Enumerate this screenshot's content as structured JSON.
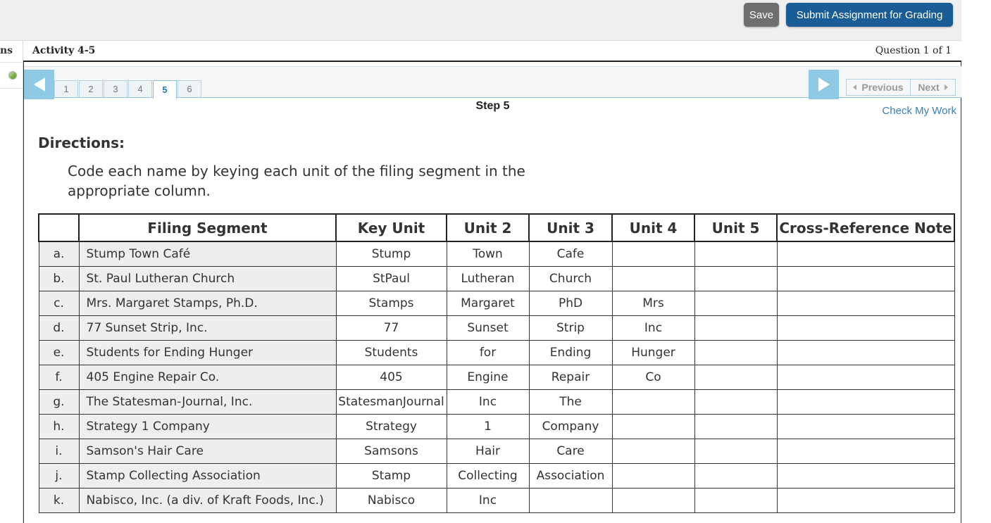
{
  "toolbar": {
    "save_label": "Save",
    "submit_label": "Submit Assignment for Grading"
  },
  "left_panel": {
    "fragment_text": "ns"
  },
  "activity": {
    "title": "Activity 4-5",
    "question_counter": "Question 1 of 1"
  },
  "steps": {
    "tabs": [
      "1",
      "2",
      "3",
      "4",
      "5",
      "6"
    ],
    "active_tab": "5",
    "previous_label": "Previous",
    "next_label": "Next",
    "current_step_label": "Step 5",
    "check_work_label": "Check My Work"
  },
  "directions": {
    "title": "Directions:",
    "text": "Code each name by keying each unit of the filing segment in the appropriate column."
  },
  "table": {
    "headers": [
      "",
      "Filing Segment",
      "Key Unit",
      "Unit 2",
      "Unit 3",
      "Unit 4",
      "Unit 5",
      "Cross-Reference Note"
    ],
    "rows": [
      {
        "label": "a.",
        "segment": "Stump Town Café",
        "units": [
          "Stump",
          "Town",
          "Cafe",
          "",
          ""
        ],
        "note": ""
      },
      {
        "label": "b.",
        "segment": "St. Paul Lutheran Church",
        "units": [
          "StPaul",
          "Lutheran",
          "Church",
          "",
          ""
        ],
        "note": ""
      },
      {
        "label": "c.",
        "segment": "Mrs. Margaret Stamps, Ph.D.",
        "units": [
          "Stamps",
          "Margaret",
          "PhD",
          "Mrs",
          ""
        ],
        "note": ""
      },
      {
        "label": "d.",
        "segment": "77 Sunset Strip, Inc.",
        "units": [
          "77",
          "Sunset",
          "Strip",
          "Inc",
          ""
        ],
        "note": ""
      },
      {
        "label": "e.",
        "segment": "Students for Ending Hunger",
        "units": [
          "Students",
          "for",
          "Ending",
          "Hunger",
          ""
        ],
        "note": ""
      },
      {
        "label": "f.",
        "segment": "405 Engine Repair Co.",
        "units": [
          "405",
          "Engine",
          "Repair",
          "Co",
          ""
        ],
        "note": ""
      },
      {
        "label": "g.",
        "segment": "The Statesman-Journal, Inc.",
        "units": [
          "StatesmanJournal",
          "Inc",
          "The",
          "",
          ""
        ],
        "note": ""
      },
      {
        "label": "h.",
        "segment": "Strategy 1 Company",
        "units": [
          "Strategy",
          "1",
          "Company",
          "",
          ""
        ],
        "note": ""
      },
      {
        "label": "i.",
        "segment": "Samson's Hair Care",
        "units": [
          "Samsons",
          "Hair",
          "Care",
          "",
          ""
        ],
        "note": ""
      },
      {
        "label": "j.",
        "segment": "Stamp Collecting Association",
        "units": [
          "Stamp",
          "Collecting",
          "Association",
          "",
          ""
        ],
        "note": ""
      },
      {
        "label": "k.",
        "segment": "Nabisco, Inc. (a div. of Kraft Foods, Inc.)",
        "units": [
          "Nabisco",
          "Inc",
          "",
          "",
          ""
        ],
        "note": ""
      }
    ]
  },
  "colors": {
    "submit_button": "#1a5d96",
    "save_button": "#6f6f6f",
    "step_arrow": "#8ec9e6",
    "active_tab_text": "#1e7bb8",
    "link": "#3a7fb5"
  }
}
